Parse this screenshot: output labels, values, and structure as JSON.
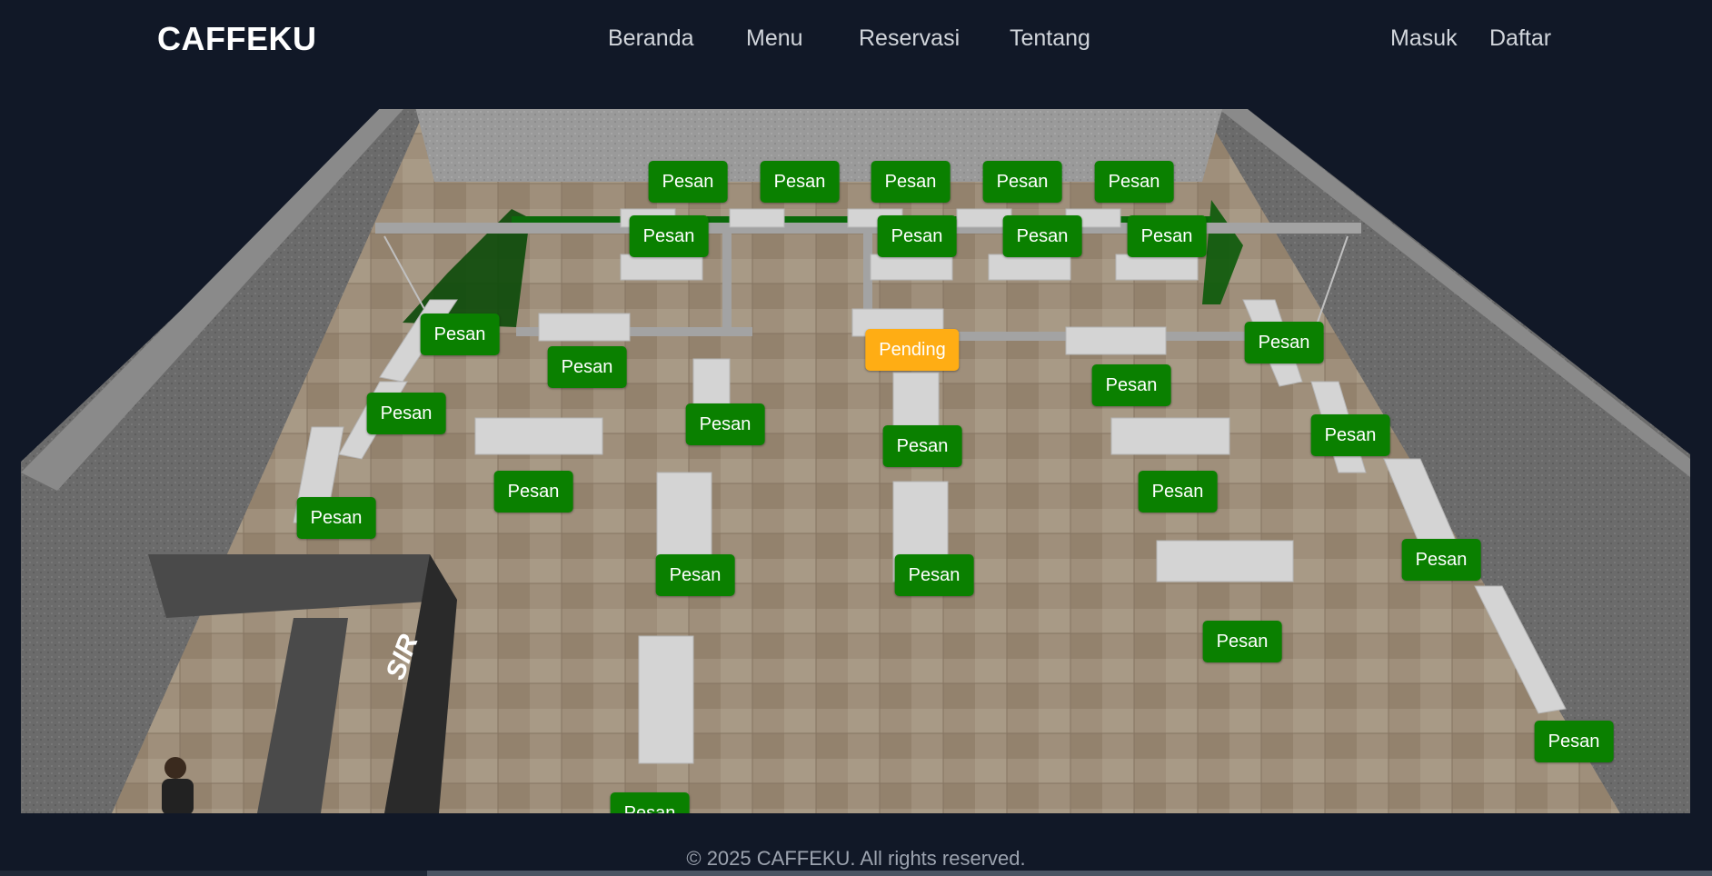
{
  "nav": {
    "brand": "CAFFEKU",
    "links": [
      "Beranda",
      "Menu",
      "Reservasi",
      "Tentang"
    ],
    "auth": {
      "login": "Masuk",
      "register": "Daftar"
    }
  },
  "scene": {
    "counter_label": "SIR",
    "tables": [
      {
        "label": "Pesan",
        "status": "available"
      },
      {
        "label": "Pesan",
        "status": "available"
      },
      {
        "label": "Pesan",
        "status": "available"
      },
      {
        "label": "Pesan",
        "status": "available"
      },
      {
        "label": "Pesan",
        "status": "available"
      },
      {
        "label": "Pesan",
        "status": "available"
      },
      {
        "label": "Pesan",
        "status": "available"
      },
      {
        "label": "Pesan",
        "status": "available"
      },
      {
        "label": "Pesan",
        "status": "available"
      },
      {
        "label": "Pesan",
        "status": "available"
      },
      {
        "label": "Pending",
        "status": "pending"
      },
      {
        "label": "Pesan",
        "status": "available"
      },
      {
        "label": "Pesan",
        "status": "available"
      },
      {
        "label": "Pesan",
        "status": "available"
      },
      {
        "label": "Pesan",
        "status": "available"
      },
      {
        "label": "Pesan",
        "status": "available"
      },
      {
        "label": "Pesan",
        "status": "available"
      },
      {
        "label": "Pesan",
        "status": "available"
      },
      {
        "label": "Pesan",
        "status": "available"
      },
      {
        "label": "Pesan",
        "status": "available"
      },
      {
        "label": "Pesan",
        "status": "available"
      },
      {
        "label": "Pesan",
        "status": "available"
      },
      {
        "label": "Pesan",
        "status": "available"
      },
      {
        "label": "Pesan",
        "status": "available"
      },
      {
        "label": "Pesan",
        "status": "available"
      },
      {
        "label": "Pesan",
        "status": "available"
      },
      {
        "label": "Pesan",
        "status": "available"
      }
    ]
  },
  "colors": {
    "available": "#0a8000",
    "pending": "#ffad14",
    "background": "#111827"
  },
  "footer": {
    "copyright": "© 2025 CAFFEKU. All rights reserved."
  }
}
